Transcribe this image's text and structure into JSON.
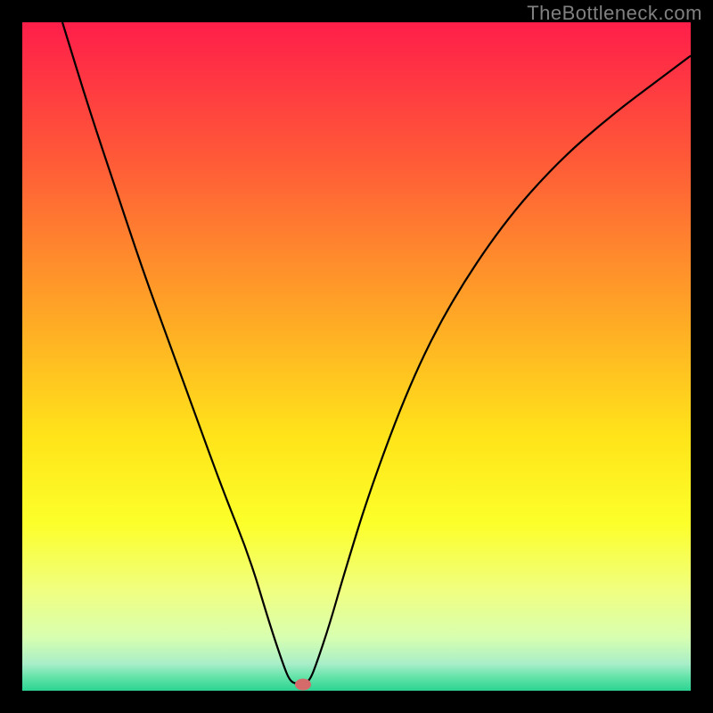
{
  "watermark": "TheBottleneck.com",
  "chart_data": {
    "type": "line",
    "title": "",
    "xlabel": "",
    "ylabel": "",
    "xlim": [
      0,
      100
    ],
    "ylim": [
      0,
      100
    ],
    "background_gradient_stops": [
      {
        "offset": 0,
        "color": "#ff1e4a"
      },
      {
        "offset": 20,
        "color": "#ff5838"
      },
      {
        "offset": 45,
        "color": "#ffab25"
      },
      {
        "offset": 62,
        "color": "#ffe41a"
      },
      {
        "offset": 75,
        "color": "#fcff2a"
      },
      {
        "offset": 85,
        "color": "#f0ff80"
      },
      {
        "offset": 92,
        "color": "#d8ffb0"
      },
      {
        "offset": 96,
        "color": "#a8eec8"
      },
      {
        "offset": 98,
        "color": "#62e3a8"
      },
      {
        "offset": 100,
        "color": "#2bd493"
      }
    ],
    "series": [
      {
        "name": "curve",
        "color": "#000000",
        "x": [
          6,
          10,
          14,
          18,
          22,
          26,
          30,
          34,
          37,
          39,
          40,
          41,
          42,
          43,
          44,
          46,
          48,
          52,
          58,
          64,
          72,
          80,
          88,
          96,
          100
        ],
        "y": [
          100,
          87,
          75,
          63,
          52,
          41,
          30,
          20,
          10,
          4,
          1.5,
          1,
          1,
          1.5,
          4,
          10,
          17,
          30,
          46,
          58,
          70,
          79,
          86,
          92,
          95
        ]
      }
    ],
    "marker": {
      "name": "minimum",
      "x": 42,
      "y": 1,
      "color": "#d46a6a"
    }
  }
}
